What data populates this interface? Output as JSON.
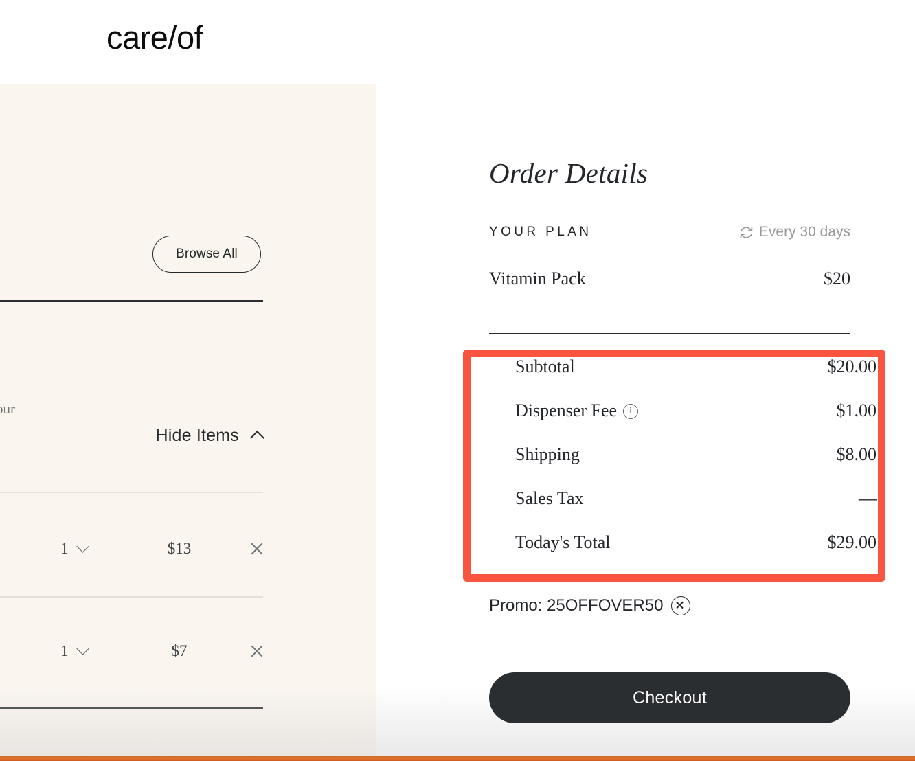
{
  "header": {
    "logo_text": "care/of"
  },
  "left_panel": {
    "browse_all_label": "Browse All",
    "clipped_text": "our",
    "hide_items_label": "Hide Items",
    "hide_items_icon": "chevron-up-icon",
    "items": [
      {
        "quantity": "1",
        "price": "$13",
        "qty_icon": "chevron-down-icon",
        "remove_icon": "close-icon"
      },
      {
        "quantity": "1",
        "price": "$7",
        "qty_icon": "chevron-down-icon",
        "remove_icon": "close-icon"
      }
    ]
  },
  "order_details": {
    "title": "Order Details",
    "plan_section_label": "YOUR PLAN",
    "cadence_icon": "refresh-icon",
    "cadence_label": "Every 30 days",
    "plan_item": {
      "name": "Vitamin Pack",
      "price": "$20"
    },
    "summary": [
      {
        "label": "Subtotal",
        "value": "$20.00",
        "info": false
      },
      {
        "label": "Dispenser Fee",
        "value": "$1.00",
        "info": true,
        "info_icon": "info-icon"
      },
      {
        "label": "Shipping",
        "value": "$8.00",
        "info": false
      },
      {
        "label": "Sales Tax",
        "value": "—",
        "info": false
      },
      {
        "label": "Today's Total",
        "value": "$29.00",
        "info": false
      }
    ],
    "promo": {
      "text": "Promo: 25OFFOVER50",
      "remove_icon": "close-circle-icon"
    },
    "checkout_label": "Checkout"
  },
  "colors": {
    "highlight_border": "#f9543f",
    "cream_panel": "#faf5ef",
    "dark": "#2b2e31",
    "muted_text": "#97999d"
  }
}
